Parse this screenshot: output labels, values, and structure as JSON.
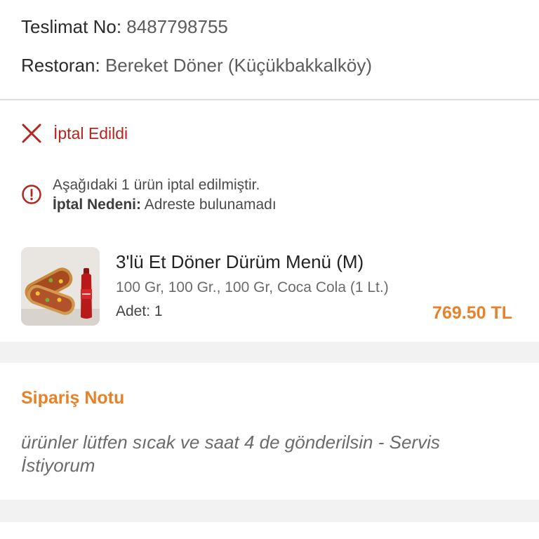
{
  "delivery": {
    "label": "Teslimat No:",
    "value": "8487798755"
  },
  "restaurant": {
    "label": "Restoran:",
    "value": "Bereket Döner (Küçükbakkalköy)"
  },
  "status": {
    "icon": "close-icon",
    "text": "İptal Edildi",
    "color": "#b3261e"
  },
  "notice": {
    "icon": "info-icon",
    "line1": "Aşağıdaki 1 ürün iptal edilmiştir.",
    "reason_label": "İptal Nedeni:",
    "reason_value": "Adreste bulunamadı"
  },
  "product": {
    "name": "3'lü Et Döner Dürüm Menü (M)",
    "description": "100 Gr, 100 Gr., 100 Gr, Coca Cola (1 Lt.)",
    "quantity": "Adet: 1",
    "price": "769.50 TL",
    "image": "doner-wrap-menu-image"
  },
  "order_note": {
    "title": "Sipariş Notu",
    "text": "ürünler lütfen sıcak ve saat 4 de gönderilsin  - Servis İstiyorum"
  },
  "colors": {
    "accent": "#e8822a",
    "cancel": "#b3261e",
    "band": "#f2f2f2"
  }
}
